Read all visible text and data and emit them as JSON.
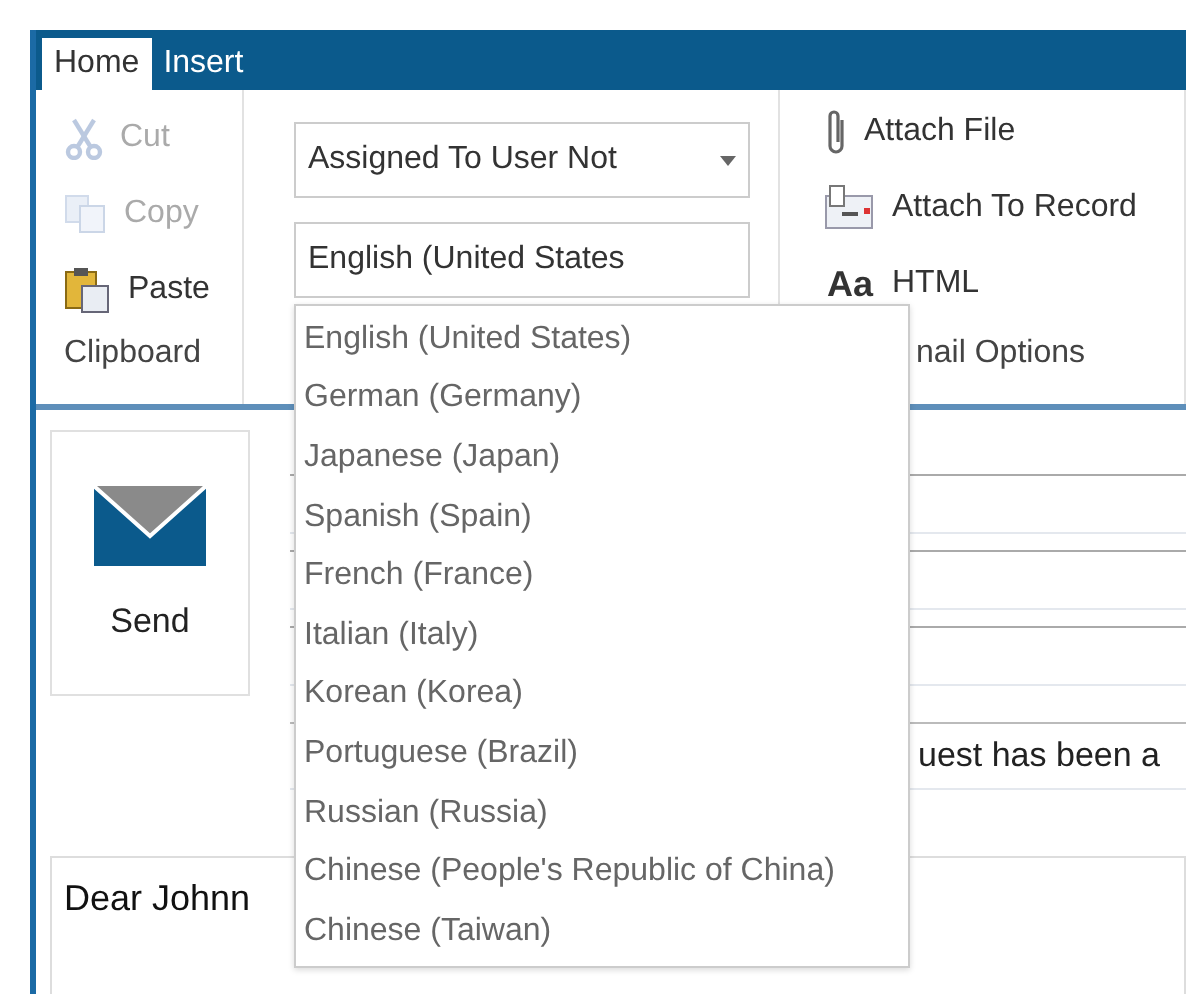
{
  "tabs": [
    {
      "label": "Home",
      "selected": true
    },
    {
      "label": "Insert",
      "selected": false
    }
  ],
  "clipboard": {
    "items": [
      {
        "kind": "cut",
        "label": "Cut",
        "disabled": true
      },
      {
        "kind": "copy",
        "label": "Copy",
        "disabled": true
      },
      {
        "kind": "paste",
        "label": "Paste",
        "disabled": false
      }
    ],
    "group_label": "Clipboard"
  },
  "template_select": {
    "value": "Assigned To User Not"
  },
  "language_select": {
    "value": "English (United States"
  },
  "email_options": {
    "items": [
      {
        "kind": "paperclip",
        "label": "Attach File"
      },
      {
        "kind": "record",
        "label": "Attach To Record"
      },
      {
        "kind": "format",
        "glyph": "Aa",
        "label": "HTML"
      }
    ],
    "group_label": "nail Options"
  },
  "send_button": {
    "label": "Send"
  },
  "subject": {
    "value": "uest has been a"
  },
  "body": {
    "value": "Dear Johnn"
  },
  "language_dropdown": {
    "options": [
      "English (United States)",
      "German (Germany)",
      "Japanese (Japan)",
      "Spanish (Spain)",
      "French (France)",
      "Italian (Italy)",
      "Korean (Korea)",
      "Portuguese (Brazil)",
      "Russian (Russia)",
      "Chinese (People's Republic of China)",
      "Chinese (Taiwan)"
    ]
  }
}
